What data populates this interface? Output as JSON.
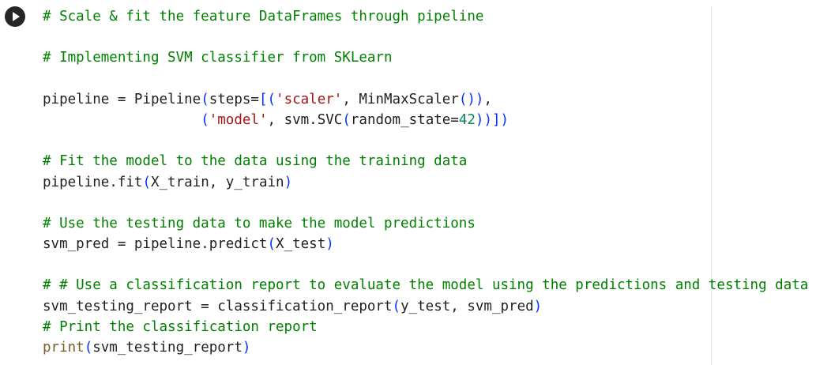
{
  "cell": {
    "run_icon": "play-icon",
    "lines": [
      [
        {
          "t": "# Scale & fit the feature DataFrames through pipeline",
          "c": "c"
        }
      ],
      [],
      [
        {
          "t": "# Implementing SVM classifier from SKLearn",
          "c": "c"
        }
      ],
      [],
      [
        {
          "t": "pipeline = Pipeline",
          "c": "t"
        },
        {
          "t": "(",
          "c": "b"
        },
        {
          "t": "steps=",
          "c": "t"
        },
        {
          "t": "[(",
          "c": "b"
        },
        {
          "t": "'scaler'",
          "c": "s"
        },
        {
          "t": ", MinMaxScaler",
          "c": "t"
        },
        {
          "t": "())",
          "c": "b"
        },
        {
          "t": ",",
          "c": "t"
        }
      ],
      [
        {
          "t": "                   ",
          "c": "t"
        },
        {
          "t": "(",
          "c": "b"
        },
        {
          "t": "'model'",
          "c": "s"
        },
        {
          "t": ", svm.SVC",
          "c": "t"
        },
        {
          "t": "(",
          "c": "b"
        },
        {
          "t": "random_state=",
          "c": "t"
        },
        {
          "t": "42",
          "c": "n"
        },
        {
          "t": "))])",
          "c": "b"
        }
      ],
      [],
      [
        {
          "t": "# Fit the model to the data using the training data",
          "c": "c"
        }
      ],
      [
        {
          "t": "pipeline.fit",
          "c": "t"
        },
        {
          "t": "(",
          "c": "b"
        },
        {
          "t": "X_train, y_train",
          "c": "t"
        },
        {
          "t": ")",
          "c": "b"
        }
      ],
      [],
      [
        {
          "t": "# Use the testing data to make the model predictions",
          "c": "c"
        }
      ],
      [
        {
          "t": "svm_pred = pipeline.predict",
          "c": "t"
        },
        {
          "t": "(",
          "c": "b"
        },
        {
          "t": "X_test",
          "c": "t"
        },
        {
          "t": ")",
          "c": "b"
        }
      ],
      [],
      [
        {
          "t": "# # Use a classification report to evaluate the model using the predictions and testing data",
          "c": "c"
        }
      ],
      [
        {
          "t": "svm_testing_report = classification_report",
          "c": "t"
        },
        {
          "t": "(",
          "c": "b"
        },
        {
          "t": "y_test, svm_pred",
          "c": "t"
        },
        {
          "t": ")",
          "c": "b"
        }
      ],
      [
        {
          "t": "# Print the classification report",
          "c": "c"
        }
      ],
      [
        {
          "t": "print",
          "c": "bi"
        },
        {
          "t": "(",
          "c": "b"
        },
        {
          "t": "svm_testing_report",
          "c": "t"
        },
        {
          "t": ")",
          "c": "b"
        }
      ]
    ]
  }
}
